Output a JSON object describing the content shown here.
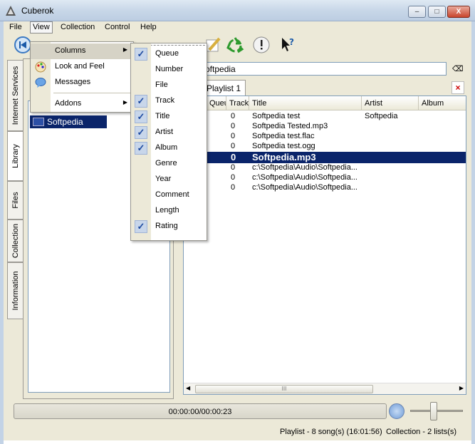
{
  "window": {
    "title": "Cuberok",
    "minimize": "–",
    "maximize": "□",
    "close": "X"
  },
  "menubar": {
    "file": "File",
    "view": "View",
    "collection": "Collection",
    "control": "Control",
    "help": "Help"
  },
  "view_menu": {
    "columns": "Columns",
    "look_and_feel": "Look and Feel",
    "messages": "Messages",
    "addons": "Addons",
    "arrow": "▶"
  },
  "columns_menu": [
    {
      "label": "Queue",
      "checked": true
    },
    {
      "label": "Number",
      "checked": false
    },
    {
      "label": "File",
      "checked": false
    },
    {
      "label": "Track",
      "checked": true
    },
    {
      "label": "Title",
      "checked": true
    },
    {
      "label": "Artist",
      "checked": true
    },
    {
      "label": "Album",
      "checked": true
    },
    {
      "label": "Genre",
      "checked": false
    },
    {
      "label": "Year",
      "checked": false
    },
    {
      "label": "Comment",
      "checked": false
    },
    {
      "label": "Length",
      "checked": false
    },
    {
      "label": "Rating",
      "checked": true
    }
  ],
  "check_mark": "✓",
  "side_tabs": [
    "Internet Services",
    "Library",
    "Files",
    "Collection",
    "Information"
  ],
  "library": {
    "item": "Softpedia"
  },
  "search": {
    "value": "oftpedia",
    "clear": "⌫"
  },
  "playlist": {
    "tab": "Playlist 1",
    "close": "×"
  },
  "table": {
    "headers": [
      "Queue",
      "Track",
      "Title",
      "Artist",
      "Album"
    ],
    "rows": [
      {
        "track": "0",
        "title": "Softpedia test",
        "artist": "Softpedia",
        "album": ""
      },
      {
        "track": "0",
        "title": "Softpedia Tested.mp3",
        "artist": "",
        "album": ""
      },
      {
        "track": "0",
        "title": "Softpedia test.flac",
        "artist": "",
        "album": ""
      },
      {
        "track": "0",
        "title": "Softpedia test.ogg",
        "artist": "",
        "album": ""
      },
      {
        "track": "0",
        "title": "Softpedia.mp3",
        "artist": "",
        "album": ""
      },
      {
        "track": "0",
        "title": "c:\\Softpedia\\Audio\\Softpedia...",
        "artist": "",
        "album": ""
      },
      {
        "track": "0",
        "title": "c:\\Softpedia\\Audio\\Softpedia...",
        "artist": "",
        "album": ""
      },
      {
        "track": "0",
        "title": "c:\\Softpedia\\Audio\\Softpedia...",
        "artist": "",
        "album": ""
      }
    ],
    "selected_row": 4,
    "scroll_grip": "III",
    "scroll_left": "◀",
    "scroll_right": "▶"
  },
  "player": {
    "time": "00:00:00/00:00:23",
    "volume_level": 0.45
  },
  "status": {
    "playlist": "Playlist - 8 song(s) (16:01:56)",
    "collection": "Collection - 2 lists(s)"
  },
  "colors": {
    "selection": "#0a246a",
    "check_bg": "#c8d6ea",
    "recycle": "#2e9a2e"
  }
}
